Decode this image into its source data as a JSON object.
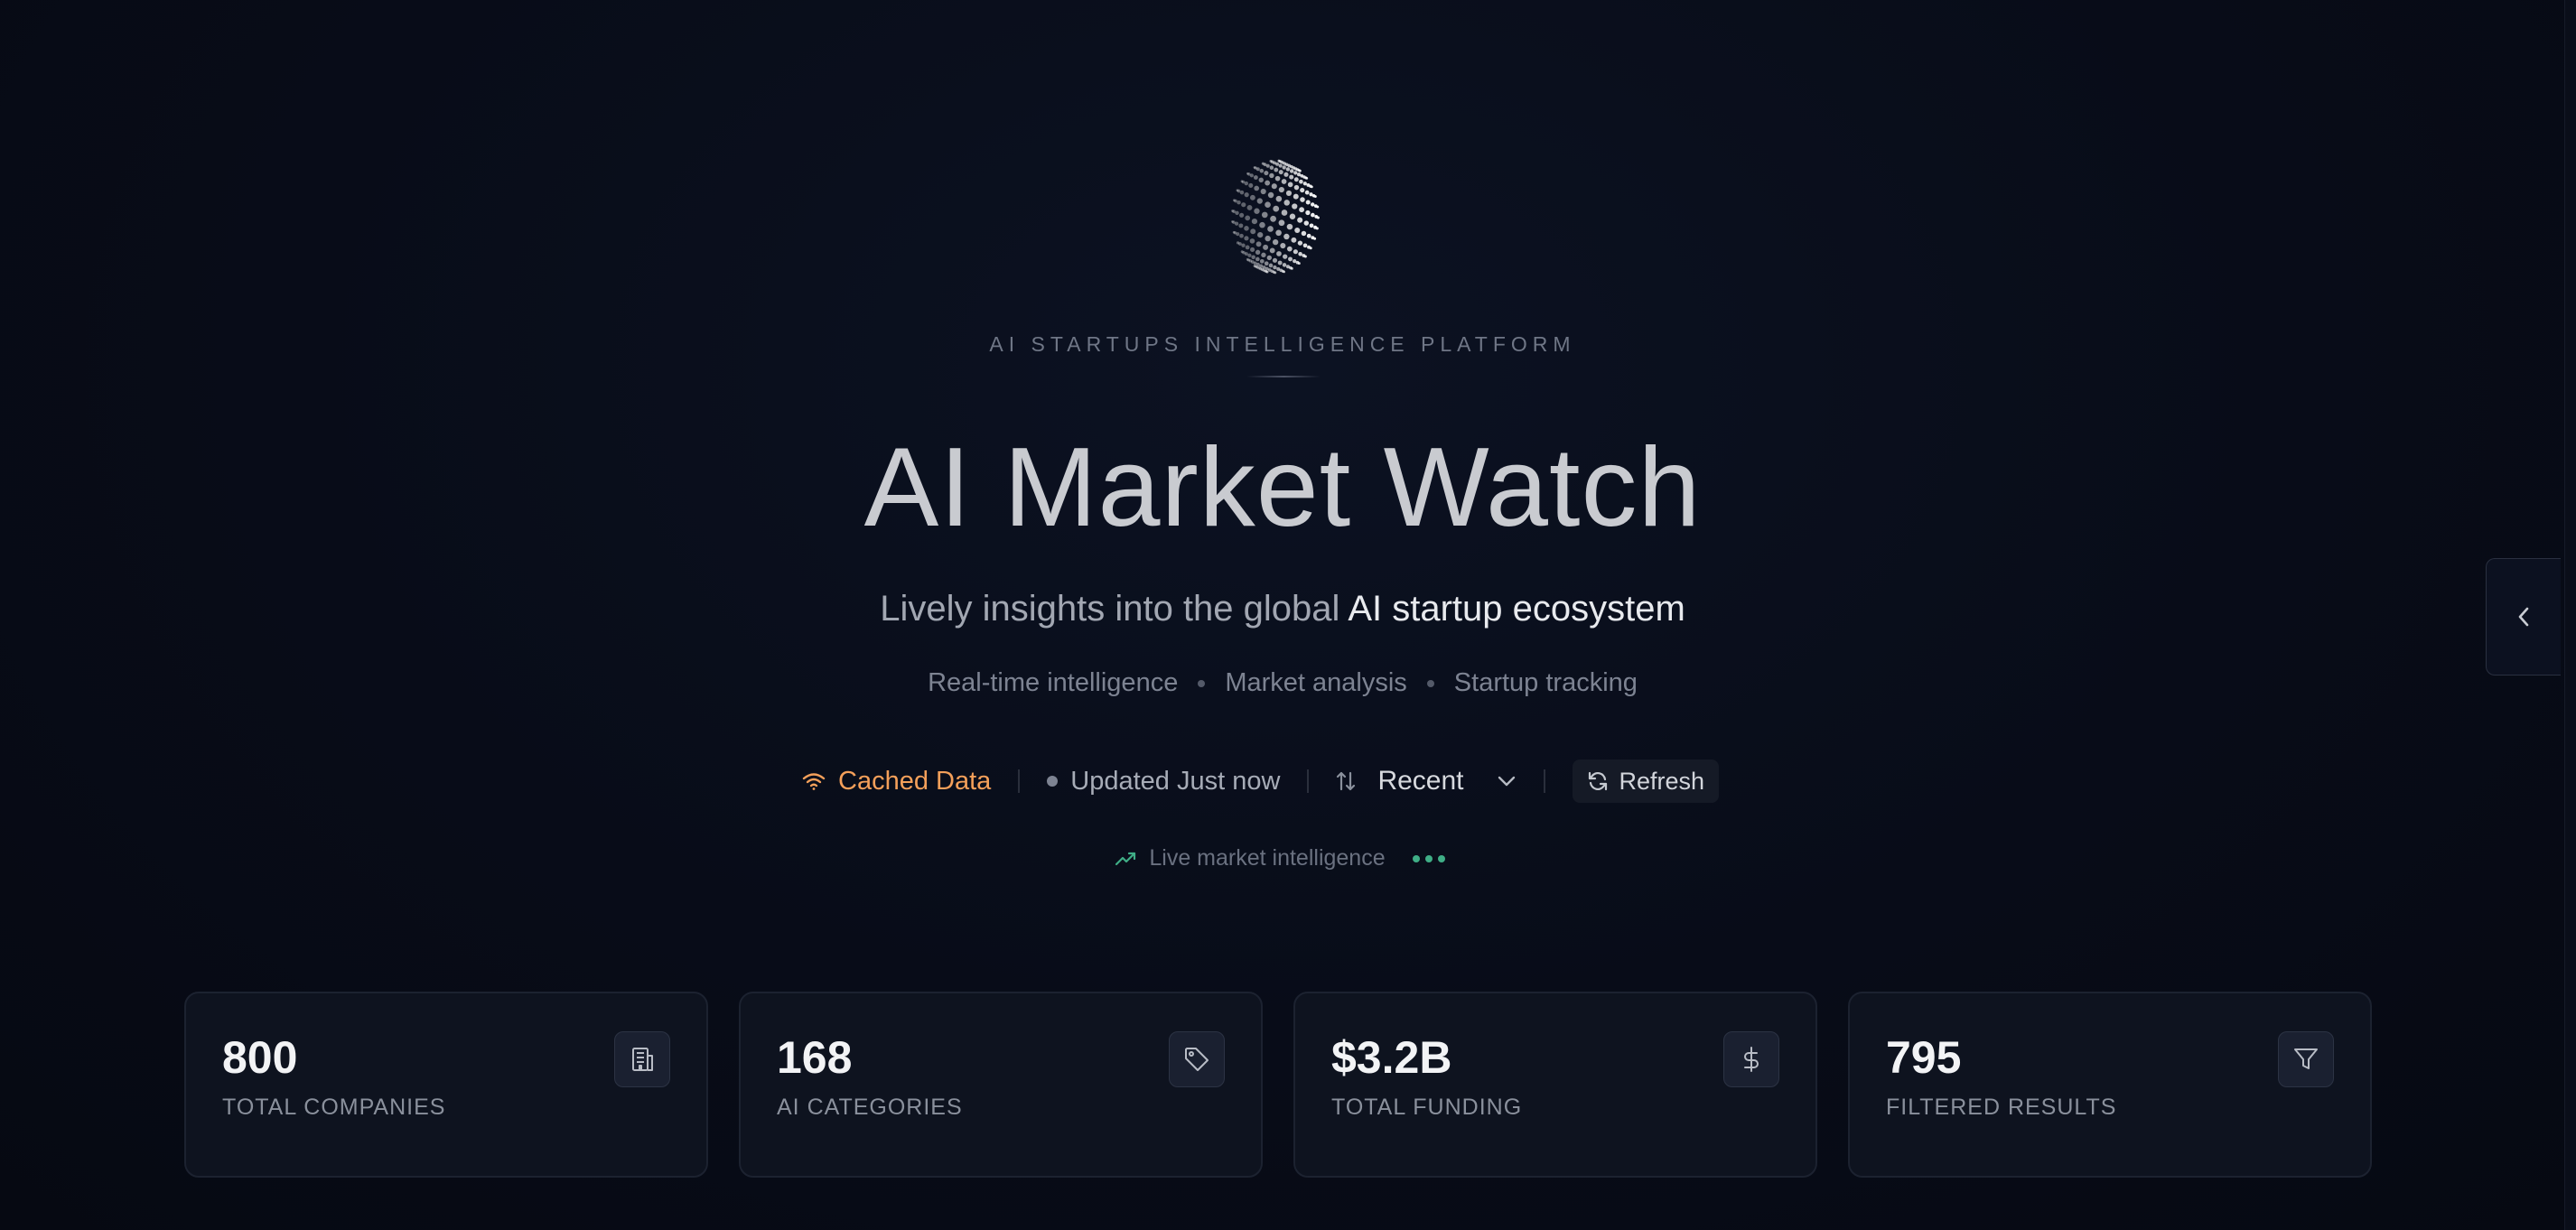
{
  "hero": {
    "eyebrow": "AI STARTUPS INTELLIGENCE PLATFORM",
    "title": "AI Market Watch",
    "subtitle_prefix": "Lively insights into the global ",
    "subtitle_highlight": "AI startup ecosystem",
    "features": [
      "Real-time intelligence",
      "Market analysis",
      "Startup tracking"
    ]
  },
  "status": {
    "cache_label": "Cached Data",
    "updated_label": "Updated Just now",
    "sort_value": "Recent",
    "refresh_label": "Refresh"
  },
  "live": {
    "label": "Live market intelligence"
  },
  "stats": [
    {
      "value": "800",
      "label": "TOTAL COMPANIES",
      "icon": "building-icon"
    },
    {
      "value": "168",
      "label": "AI CATEGORIES",
      "icon": "tag-icon"
    },
    {
      "value": "$3.2B",
      "label": "TOTAL FUNDING",
      "icon": "dollar-icon"
    },
    {
      "value": "795",
      "label": "FILTERED RESULTS",
      "icon": "filter-icon"
    }
  ],
  "colors": {
    "background": "#070b16",
    "accent_orange": "#f4a05a",
    "accent_green": "#3fae86"
  }
}
